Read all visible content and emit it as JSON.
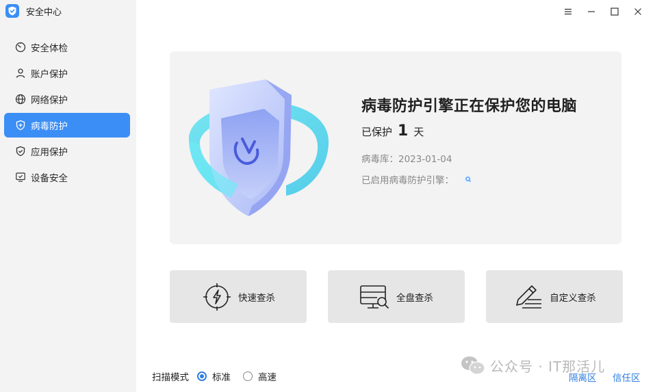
{
  "app": {
    "title": "安全中心"
  },
  "sidebar": {
    "items": [
      {
        "label": "安全体检",
        "icon": "gauge-icon",
        "active": false
      },
      {
        "label": "账户保护",
        "icon": "user-icon",
        "active": false
      },
      {
        "label": "网络保护",
        "icon": "globe-icon",
        "active": false
      },
      {
        "label": "病毒防护",
        "icon": "shield-plus-icon",
        "active": true
      },
      {
        "label": "应用保护",
        "icon": "shield-check-icon",
        "active": false
      },
      {
        "label": "设备安全",
        "icon": "monitor-check-icon",
        "active": false
      }
    ]
  },
  "window_controls": [
    "menu-icon",
    "minimize-icon",
    "maximize-icon",
    "close-icon"
  ],
  "hero": {
    "title": "病毒防护引擎正在保护您的电脑",
    "protected_prefix": "已保护",
    "protected_days": "1",
    "protected_suffix": "天",
    "virus_db": "病毒库：2023-01-04",
    "engine_label": "已启用病毒防护引擎："
  },
  "scan_cards": [
    {
      "label": "快速查杀",
      "icon": "lightning-target-icon"
    },
    {
      "label": "全盘查杀",
      "icon": "disk-search-icon"
    },
    {
      "label": "自定义查杀",
      "icon": "pen-list-icon"
    }
  ],
  "scan_mode": {
    "label": "扫描模式",
    "options": [
      {
        "label": "标准",
        "checked": true
      },
      {
        "label": "高速",
        "checked": false
      }
    ]
  },
  "links": {
    "quarantine": "隔离区",
    "trust": "信任区"
  },
  "watermark": {
    "text": "公众号 · IT那活儿"
  },
  "colors": {
    "accent": "#3b8ef5",
    "link": "#2f7de1",
    "sidebar_bg": "#f3f3f3",
    "card_bg": "#e6e6e6"
  }
}
